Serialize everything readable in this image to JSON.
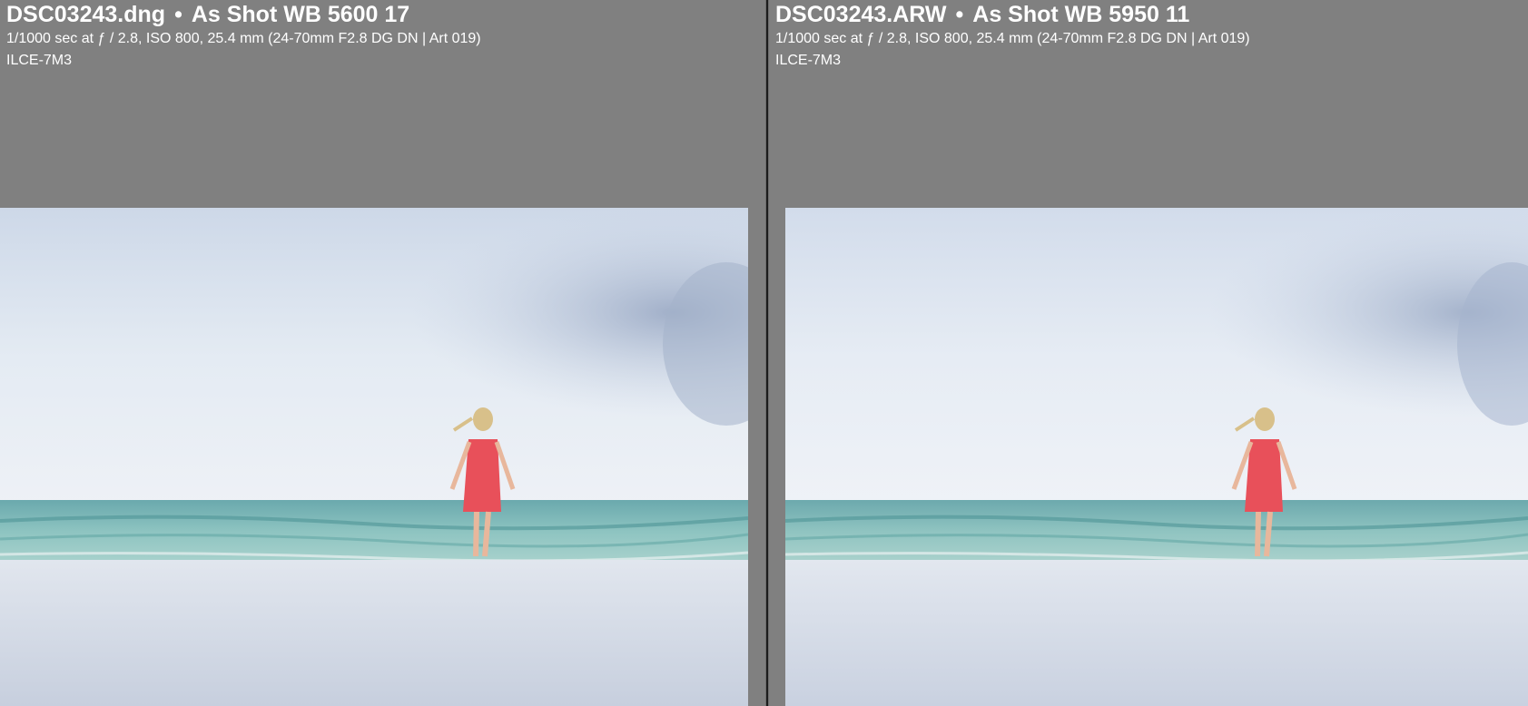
{
  "left_panel": {
    "filename": "DSC03243.dng",
    "separator": "•",
    "white_balance": "As Shot WB 5600 17",
    "exposure_info": "1/1000 sec at ƒ / 2.8, ISO 800, 25.4 mm (24-70mm F2.8 DG DN | Art 019)",
    "camera_model": "ILCE-7M3"
  },
  "right_panel": {
    "filename": "DSC03243.ARW",
    "separator": "•",
    "white_balance": "As Shot WB 5950 11",
    "exposure_info": "1/1000 sec at ƒ / 2.8, ISO 800, 25.4 mm (24-70mm F2.8 DG DN | Art 019)",
    "camera_model": "ILCE-7M3"
  },
  "colors": {
    "background": "#808080",
    "divider": "#1c1c1c",
    "dress": "#e8505a",
    "sea": "#6fb1ad",
    "sky": "#e4ebf3",
    "sand": "#d5dbe6"
  }
}
